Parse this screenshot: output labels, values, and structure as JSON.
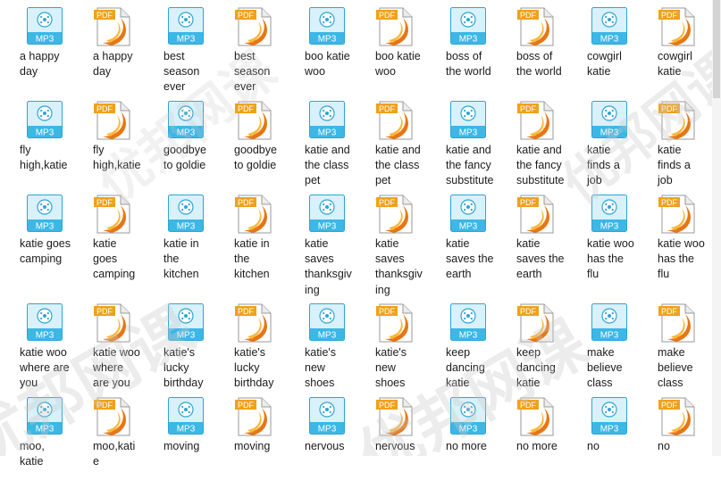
{
  "colors": {
    "mp3_body": "#d8f1fb",
    "mp3_border": "#2ea5d4",
    "mp3_band": "#3cb7e6",
    "pdf_tag": "#f0a11c",
    "pdf_swoosh_outer": "#e77614",
    "pdf_swoosh_inner": "#f9b93b",
    "watermark": "#c9c9c9"
  },
  "watermark": {
    "text": "优邦网课"
  },
  "files": [
    {
      "type": "mp3",
      "label": "a happy day",
      "badge": "MP3",
      "icon": "mp3-audio-file-icon"
    },
    {
      "type": "pdf",
      "label": "a happy day",
      "badge": "PDF",
      "icon": "pdf-document-icon"
    },
    {
      "type": "mp3",
      "label": "best season ever",
      "badge": "MP3",
      "icon": "mp3-audio-file-icon"
    },
    {
      "type": "pdf",
      "label": "best season ever",
      "badge": "PDF",
      "icon": "pdf-document-icon"
    },
    {
      "type": "mp3",
      "label": "boo katie woo",
      "badge": "MP3",
      "icon": "mp3-audio-file-icon"
    },
    {
      "type": "pdf",
      "label": "boo katie woo",
      "badge": "PDF",
      "icon": "pdf-document-icon"
    },
    {
      "type": "mp3",
      "label": "boss of the world",
      "badge": "MP3",
      "icon": "mp3-audio-file-icon"
    },
    {
      "type": "pdf",
      "label": "boss of the world",
      "badge": "PDF",
      "icon": "pdf-document-icon"
    },
    {
      "type": "mp3",
      "label": "cowgirl katie",
      "badge": "MP3",
      "icon": "mp3-audio-file-icon"
    },
    {
      "type": "pdf",
      "label": "cowgirl katie",
      "badge": "PDF",
      "icon": "pdf-document-icon"
    },
    {
      "type": "mp3",
      "label": "fly high,katie",
      "badge": "MP3",
      "icon": "mp3-audio-file-icon"
    },
    {
      "type": "pdf",
      "label": "fly high,katie",
      "badge": "PDF",
      "icon": "pdf-document-icon"
    },
    {
      "type": "mp3",
      "label": "goodbye to goldie",
      "badge": "MP3",
      "icon": "mp3-audio-file-icon"
    },
    {
      "type": "pdf",
      "label": "goodbye to goldie",
      "badge": "PDF",
      "icon": "pdf-document-icon"
    },
    {
      "type": "mp3",
      "label": "katie and the class pet",
      "badge": "MP3",
      "icon": "mp3-audio-file-icon"
    },
    {
      "type": "pdf",
      "label": "katie and the class pet",
      "badge": "PDF",
      "icon": "pdf-document-icon"
    },
    {
      "type": "mp3",
      "label": "katie and the fancy substitute",
      "badge": "MP3",
      "icon": "mp3-audio-file-icon"
    },
    {
      "type": "pdf",
      "label": "katie and the fancy substitute",
      "badge": "PDF",
      "icon": "pdf-document-icon"
    },
    {
      "type": "mp3",
      "label": "katie finds a job",
      "badge": "MP3",
      "icon": "mp3-audio-file-icon"
    },
    {
      "type": "pdf",
      "label": "katie finds a job",
      "badge": "PDF",
      "icon": "pdf-document-icon"
    },
    {
      "type": "mp3",
      "label": "katie goes camping",
      "badge": "MP3",
      "icon": "mp3-audio-file-icon"
    },
    {
      "type": "pdf",
      "label": "katie goes camping",
      "badge": "PDF",
      "icon": "pdf-document-icon"
    },
    {
      "type": "mp3",
      "label": "katie in the kitchen",
      "badge": "MP3",
      "icon": "mp3-audio-file-icon"
    },
    {
      "type": "pdf",
      "label": "katie in the kitchen",
      "badge": "PDF",
      "icon": "pdf-document-icon"
    },
    {
      "type": "mp3",
      "label": "katie saves thanksgiving",
      "badge": "MP3",
      "icon": "mp3-audio-file-icon"
    },
    {
      "type": "pdf",
      "label": "katie saves thanksgiving",
      "badge": "PDF",
      "icon": "pdf-document-icon"
    },
    {
      "type": "mp3",
      "label": "katie saves the earth",
      "badge": "MP3",
      "icon": "mp3-audio-file-icon"
    },
    {
      "type": "pdf",
      "label": "katie saves the earth",
      "badge": "PDF",
      "icon": "pdf-document-icon"
    },
    {
      "type": "mp3",
      "label": "katie woo has the flu",
      "badge": "MP3",
      "icon": "mp3-audio-file-icon"
    },
    {
      "type": "pdf",
      "label": "katie woo has the flu",
      "badge": "PDF",
      "icon": "pdf-document-icon"
    },
    {
      "type": "mp3",
      "label": "katie woo where are you",
      "badge": "MP3",
      "icon": "mp3-audio-file-icon"
    },
    {
      "type": "pdf",
      "label": "katie woo where are you",
      "badge": "PDF",
      "icon": "pdf-document-icon"
    },
    {
      "type": "mp3",
      "label": "katie's lucky birthday",
      "badge": "MP3",
      "icon": "mp3-audio-file-icon"
    },
    {
      "type": "pdf",
      "label": "katie's lucky birthday",
      "badge": "PDF",
      "icon": "pdf-document-icon"
    },
    {
      "type": "mp3",
      "label": "katie's new shoes",
      "badge": "MP3",
      "icon": "mp3-audio-file-icon"
    },
    {
      "type": "pdf",
      "label": "katie's new shoes",
      "badge": "PDF",
      "icon": "pdf-document-icon"
    },
    {
      "type": "mp3",
      "label": "keep dancing katie",
      "badge": "MP3",
      "icon": "mp3-audio-file-icon"
    },
    {
      "type": "pdf",
      "label": "keep dancing katie",
      "badge": "PDF",
      "icon": "pdf-document-icon"
    },
    {
      "type": "mp3",
      "label": "make believe class",
      "badge": "MP3",
      "icon": "mp3-audio-file-icon"
    },
    {
      "type": "pdf",
      "label": "make believe class",
      "badge": "PDF",
      "icon": "pdf-document-icon"
    },
    {
      "type": "mp3",
      "label": "moo, katie",
      "badge": "MP3",
      "icon": "mp3-audio-file-icon"
    },
    {
      "type": "pdf",
      "label": "moo,katie",
      "badge": "PDF",
      "icon": "pdf-document-icon"
    },
    {
      "type": "mp3",
      "label": "moving",
      "badge": "MP3",
      "icon": "mp3-audio-file-icon"
    },
    {
      "type": "pdf",
      "label": "moving",
      "badge": "PDF",
      "icon": "pdf-document-icon"
    },
    {
      "type": "mp3",
      "label": "nervous",
      "badge": "MP3",
      "icon": "mp3-audio-file-icon"
    },
    {
      "type": "pdf",
      "label": "nervous",
      "badge": "PDF",
      "icon": "pdf-document-icon"
    },
    {
      "type": "mp3",
      "label": "no more",
      "badge": "MP3",
      "icon": "mp3-audio-file-icon"
    },
    {
      "type": "pdf",
      "label": "no more",
      "badge": "PDF",
      "icon": "pdf-document-icon"
    },
    {
      "type": "mp3",
      "label": "no",
      "badge": "MP3",
      "icon": "mp3-audio-file-icon"
    },
    {
      "type": "pdf",
      "label": "no",
      "badge": "PDF",
      "icon": "pdf-document-icon"
    }
  ]
}
